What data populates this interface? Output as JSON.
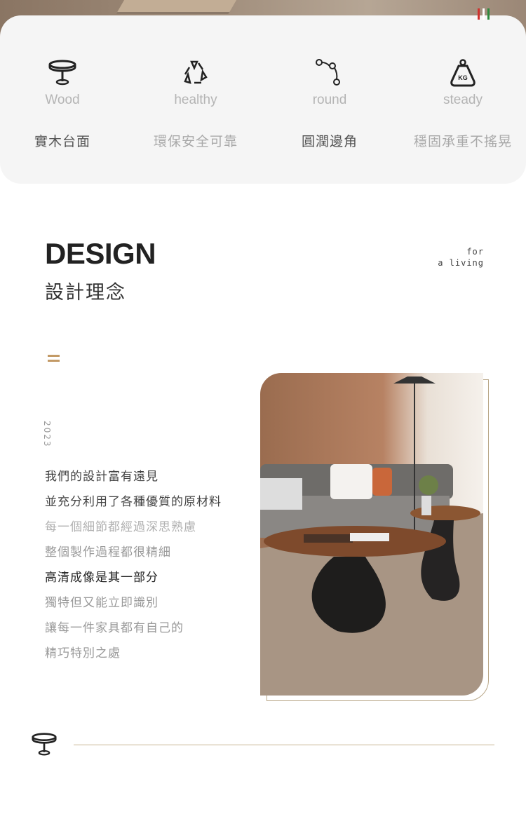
{
  "features": [
    {
      "icon": "table-icon",
      "en": "Wood",
      "zh": "實木台面"
    },
    {
      "icon": "recycle-icon",
      "en": "healthy",
      "zh": "環保安全可靠"
    },
    {
      "icon": "curve-nodes-icon",
      "en": "round",
      "zh": "圓潤邊角"
    },
    {
      "icon": "kg-weight-icon",
      "en": "steady",
      "zh": "穩固承重不搖晃",
      "kg": "KG"
    }
  ],
  "flag_colors": [
    "#d0312d",
    "#ffffff",
    "#2e8b3e"
  ],
  "accent": "#c39a66",
  "design": {
    "title": "DESIGN",
    "subtitle": "設計理念",
    "tag1": "for",
    "tag2": "a living",
    "year": "2023",
    "lines": [
      "我們的設計富有遠見",
      "並充分利用了各種優質的原材料",
      "每一個細節都經過深思熟慮",
      "整個製作過程都很精細",
      "高清成像是其一部分",
      "獨特但又能立即識別",
      "讓每一件家具都有自己的",
      "精巧特別之處"
    ]
  }
}
